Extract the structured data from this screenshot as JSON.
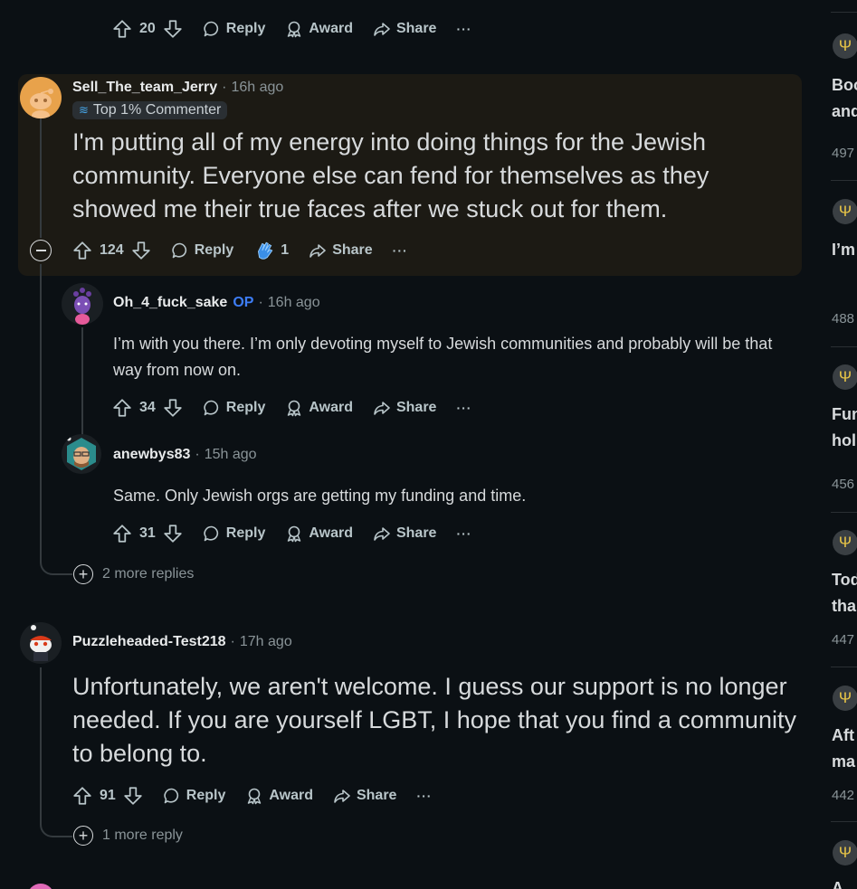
{
  "top_actions": {
    "votes": "20",
    "reply": "Reply",
    "award": "Award",
    "share": "Share",
    "more": "···"
  },
  "comment1": {
    "author": "Sell_The_team_Jerry",
    "time": "16h ago",
    "badge": "Top 1% Commenter",
    "text": "I'm putting all of my energy into doing things for the Jewish community.  Everyone else can fend for themselves as they showed me their true faces after we stuck out for them.",
    "votes": "124",
    "reply": "Reply",
    "award_count": "1",
    "share": "Share",
    "more": "···"
  },
  "reply1": {
    "author": "Oh_4_fuck_sake",
    "op": "OP",
    "time": "16h ago",
    "text": "I’m with you there. I’m only devoting myself to Jewish communities and probably will be that way from now on.",
    "votes": "34",
    "reply": "Reply",
    "award": "Award",
    "share": "Share",
    "more": "···"
  },
  "reply2": {
    "author": "anewbys83",
    "time": "15h ago",
    "text": "Same. Only Jewish orgs are getting my funding and time.",
    "votes": "31",
    "reply": "Reply",
    "award": "Award",
    "share": "Share",
    "more": "···"
  },
  "more_replies_1": "2 more replies",
  "comment2": {
    "author": "Puzzleheaded-Test218",
    "time": "17h ago",
    "text": "Unfortunately, we aren't welcome. I guess our support is no longer needed. If you are yourself LGBT, I hope that you find a community to belong to.",
    "votes": "91",
    "reply": "Reply",
    "award": "Award",
    "share": "Share",
    "more": "···"
  },
  "more_replies_2": "1 more reply",
  "sidebar": {
    "icon": "menorah-icon",
    "items": [
      {
        "line1": "Boo",
        "line2": "and",
        "num": "497"
      },
      {
        "line1": "I’m",
        "line2": "",
        "num": "488"
      },
      {
        "line1": "Fun",
        "line2": "hol",
        "num": "456"
      },
      {
        "line1": "Tod",
        "line2": "tha",
        "num": "447"
      },
      {
        "line1": "Aft",
        "line2": "ma",
        "num": "442"
      },
      {
        "line1": "A",
        "line2": "",
        "num": ""
      }
    ]
  },
  "colors": {
    "background": "#0b1014",
    "highlight": "#1c1a14",
    "op": "#3d7df5",
    "text": "#d7dadc",
    "muted": "#8a9498"
  }
}
